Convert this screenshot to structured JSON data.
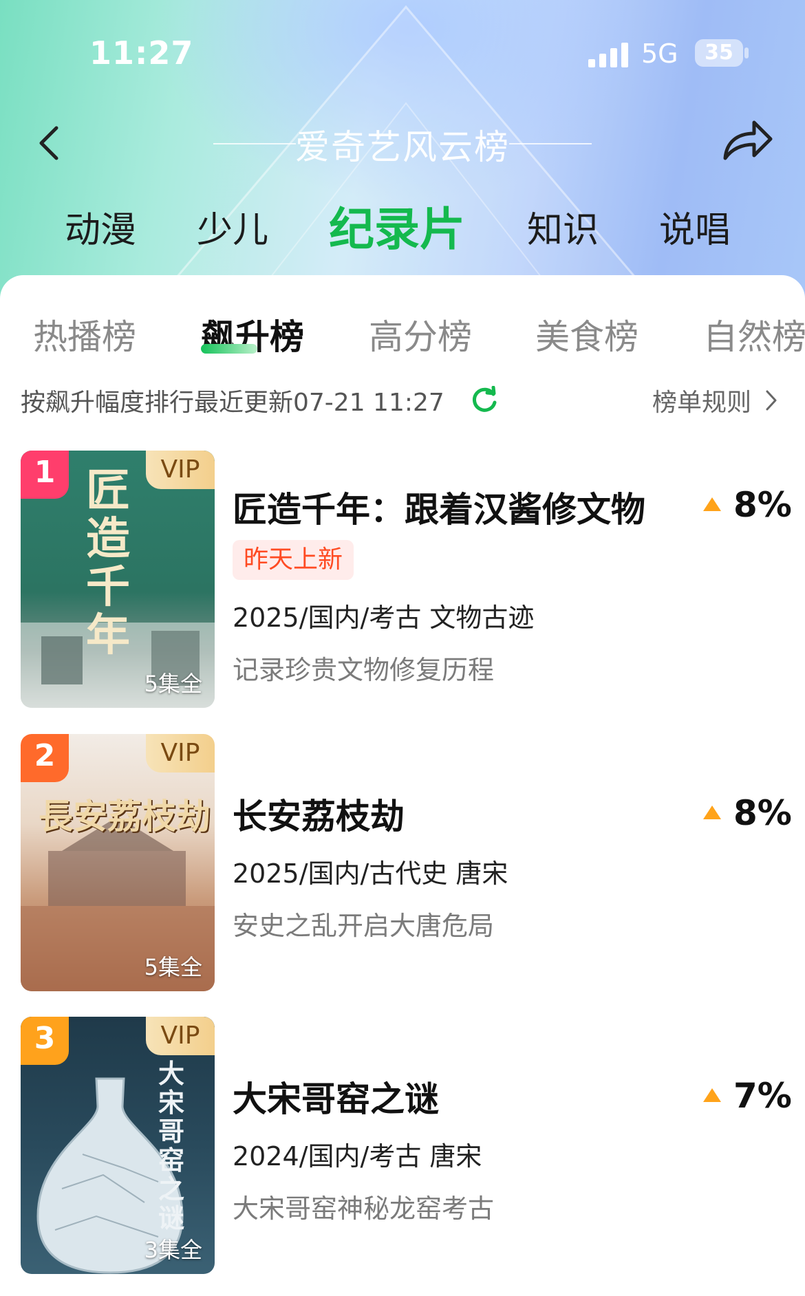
{
  "status_bar": {
    "time": "11:27",
    "network": "5G",
    "battery": "35"
  },
  "header": {
    "title": "爱奇艺风云榜"
  },
  "categories": [
    "动漫",
    "少儿",
    "纪录片",
    "知识",
    "说唱"
  ],
  "active_category": "纪录片",
  "subtabs": [
    "热播榜",
    "飙升榜",
    "高分榜",
    "美食榜",
    "自然榜"
  ],
  "active_subtab": "飙升榜",
  "info": {
    "text": "按飙升幅度排行最近更新07-21 11:27",
    "rules": "榜单规则"
  },
  "items": [
    {
      "rank": "1",
      "vip": "VIP",
      "episodes": "5集全",
      "poster_text": "匠造千年",
      "title": "匠造千年：跟着汉酱修文物",
      "badge": "昨天上新",
      "meta": "2025/国内/考古 文物古迹",
      "desc": "记录珍贵文物修复历程",
      "rise": "8%"
    },
    {
      "rank": "2",
      "vip": "VIP",
      "episodes": "5集全",
      "poster_text": "長安荔枝劫",
      "title": "长安荔枝劫",
      "meta": "2025/国内/古代史 唐宋",
      "desc": "安史之乱开启大唐危局",
      "rise": "8%"
    },
    {
      "rank": "3",
      "vip": "VIP",
      "episodes": "3集全",
      "poster_text": "大宋哥窑之谜",
      "title": "大宋哥窑之谜",
      "meta": "2024/国内/考古 唐宋",
      "desc": "大宋哥窑神秘龙窑考古",
      "rise": "7%"
    }
  ],
  "colors": {
    "accent_green": "#14b94e",
    "rank1": "#ff3e6c",
    "rank2": "#ff6a2b",
    "rank3": "#ffa21c",
    "rise_arrow": "#ffa31a"
  }
}
